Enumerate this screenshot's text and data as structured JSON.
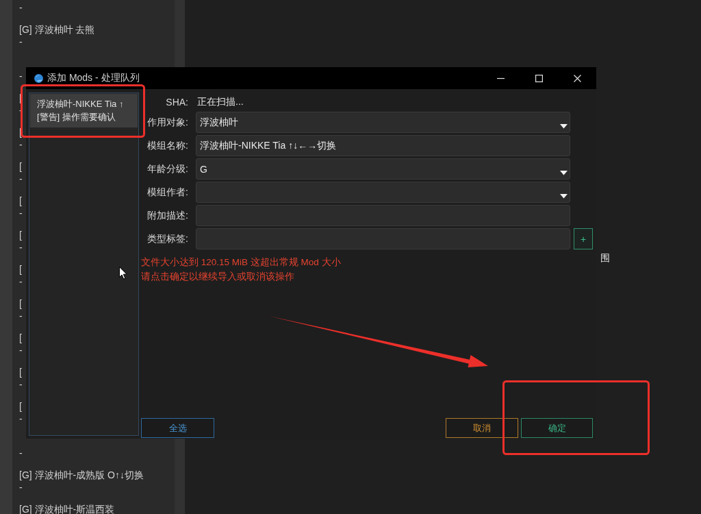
{
  "background_list": {
    "items": [
      {
        "subtitle": "-"
      },
      {
        "title": "[G] 浮波柚叶 去熊",
        "subtitle": "-"
      },
      {
        "subtitle": "-"
      },
      {
        "title": "[",
        "subtitle": "-"
      },
      {
        "title": "[",
        "subtitle": "-"
      },
      {
        "title": "[",
        "subtitle": "-"
      },
      {
        "title": "[",
        "subtitle": "-"
      },
      {
        "title": "[",
        "subtitle": "-"
      },
      {
        "title": "[",
        "subtitle": "-"
      },
      {
        "title": "[",
        "subtitle": "-"
      },
      {
        "title": "[",
        "subtitle": "-"
      },
      {
        "title": "[",
        "subtitle": "-"
      },
      {
        "title": "[",
        "subtitle": "-"
      },
      {
        "subtitle": "-"
      },
      {
        "title": "[G] 浮波柚叶-成熟版 O↑↓切换",
        "subtitle": "-"
      },
      {
        "title": "[G] 浮波柚叶-斯温西装"
      }
    ]
  },
  "background_text": "围",
  "dialog": {
    "title": "添加 Mods - 处理队列",
    "queue": [
      {
        "name": "浮波柚叶-NIKKE Tia ↑",
        "status": "[警告] 操作需要确认",
        "selected": true
      }
    ],
    "fields": [
      {
        "kind": "readonly",
        "label": "SHA:",
        "value": "正在扫描..."
      },
      {
        "kind": "dropdown",
        "label": "作用对象:",
        "value": "浮波柚叶"
      },
      {
        "kind": "text",
        "label": "模组名称:",
        "value": "浮波柚叶-NIKKE Tia ↑↓←→切换"
      },
      {
        "kind": "dropdown",
        "label": "年龄分级:",
        "value": "G"
      },
      {
        "kind": "dropdown",
        "label": "模组作者:"
      },
      {
        "kind": "text",
        "label": "附加描述:"
      },
      {
        "kind": "tags",
        "label": "类型标签:",
        "add_button": "+"
      }
    ],
    "warning": [
      "文件大小达到 120.15 MiB 这超出常规 Mod 大小",
      "请点击确定以继续导入或取消该操作"
    ],
    "buttons": [
      {
        "kind": "select_all",
        "label": "全选"
      },
      {
        "kind": "cancel",
        "label": "取消"
      },
      {
        "kind": "confirm",
        "label": "确定"
      }
    ]
  },
  "annotations": [
    {
      "kind": "frame"
    },
    {
      "kind": "frame"
    },
    {
      "kind": "arrow"
    }
  ]
}
